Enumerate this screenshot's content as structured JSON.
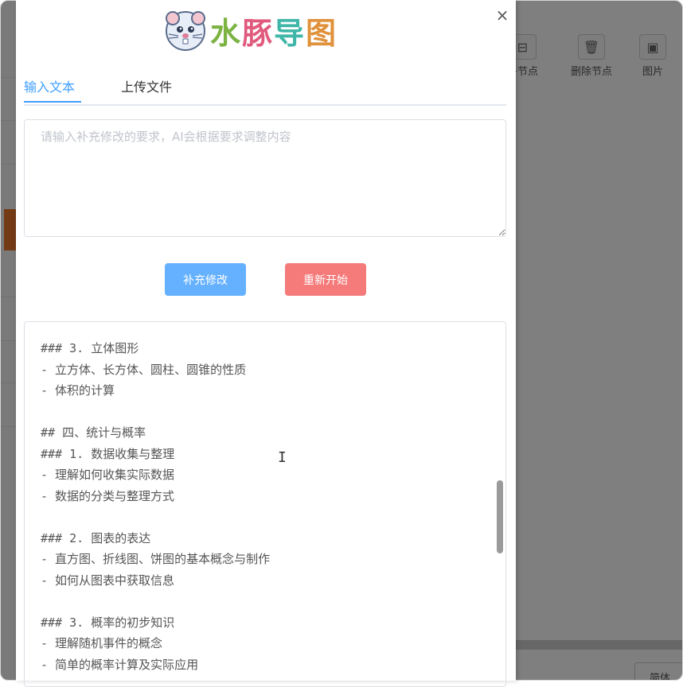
{
  "background": {
    "toolbar": {
      "child_node": "子节点",
      "delete_node": "删除节点",
      "image": "图片"
    },
    "bottom_button": "简体"
  },
  "dialog": {
    "close_icon": "×",
    "logo": {
      "mascot_icon": "rat-mascot-icon",
      "brand_chars": [
        {
          "char": "水",
          "color": "#7cb342"
        },
        {
          "char": "豚",
          "color": "#e05a7d"
        },
        {
          "char": "导",
          "color": "#3fb6a8"
        },
        {
          "char": "图",
          "color": "#e0913a"
        }
      ]
    },
    "tabs": [
      {
        "label": "输入文本",
        "active": true
      },
      {
        "label": "上传文件",
        "active": false
      }
    ],
    "input": {
      "placeholder": "请输入补充修改的要求，AI会根据要求调整内容",
      "value": ""
    },
    "buttons": {
      "supplement": "补充修改",
      "restart": "重新开始"
    },
    "output_lines": [
      "### 3. 立体图形",
      "- 立方体、长方体、圆柱、圆锥的性质",
      "- 体积的计算",
      "",
      "## 四、统计与概率",
      "### 1. 数据收集与整理",
      "- 理解如何收集实际数据",
      "- 数据的分类与整理方式",
      "",
      "### 2. 图表的表达",
      "- 直方图、折线图、饼图的基本概念与制作",
      "- 如何从图表中获取信息",
      "",
      "### 3. 概率的初步知识",
      "- 理解随机事件的概念",
      "- 简单的概率计算及实际应用"
    ],
    "text_cursor_icon": "I"
  }
}
